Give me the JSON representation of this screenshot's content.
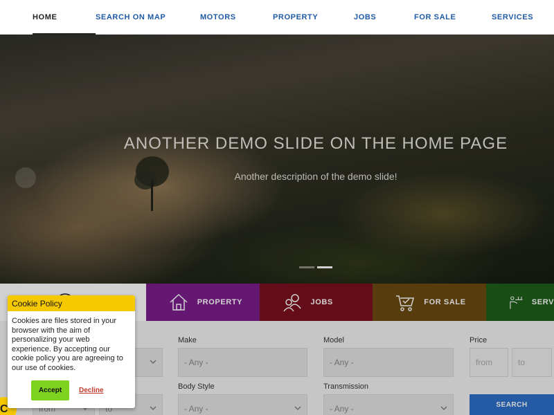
{
  "nav": {
    "items": [
      {
        "label": "HOME",
        "active": true
      },
      {
        "label": "SEARCH ON MAP"
      },
      {
        "label": "MOTORS"
      },
      {
        "label": "PROPERTY"
      },
      {
        "label": "JOBS"
      },
      {
        "label": "FOR SALE"
      },
      {
        "label": "SERVICES"
      }
    ]
  },
  "hero": {
    "title": "ANOTHER DEMO SLIDE ON THE HOME PAGE",
    "description": "Another description of the demo slide!"
  },
  "tabs": [
    {
      "label": "",
      "icon": "car-icon"
    },
    {
      "label": "PROPERTY",
      "icon": "house-icon"
    },
    {
      "label": "JOBS",
      "icon": "people-icon"
    },
    {
      "label": "FOR SALE",
      "icon": "cart-icon"
    },
    {
      "label": "SERV",
      "icon": "service-icon"
    }
  ],
  "search": {
    "make_label": "Make",
    "make_value": "- Any -",
    "model_label": "Model",
    "model_value": "- Any -",
    "price_label": "Price",
    "price_from": "from",
    "price_to": "to",
    "body_style_label": "Body Style",
    "body_style_value": "- Any -",
    "transmission_label": "Transmission",
    "transmission_value": "- Any -",
    "year_from": "from",
    "year_to": "to",
    "search_button": "SEARCH"
  },
  "cookie": {
    "title": "Cookie Policy",
    "text": "Cookies are files stored in your browser with the aim of personalizing your web experience. By accepting our cookie policy you are agreeing to our use of cookies.",
    "accept": "Accept",
    "decline": "Decline",
    "badge": "C"
  },
  "colors": {
    "nav_link": "#1f5aa6",
    "property": "#7b1e8c",
    "jobs": "#7a0f1d",
    "for_sale": "#6b4a12",
    "services": "#1f5e1c",
    "cookie_header": "#f6c800",
    "accept": "#7ed321",
    "search_button": "#2c6fc9"
  }
}
